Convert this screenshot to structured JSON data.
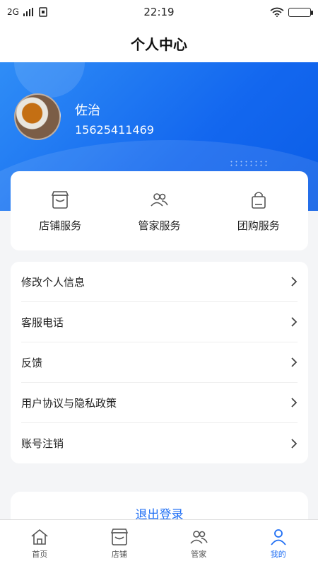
{
  "status_bar": {
    "network": "2G",
    "time": "22:19"
  },
  "header": {
    "title": "个人中心"
  },
  "user": {
    "name": "佐治",
    "phone": "15625411469"
  },
  "services": [
    {
      "label": "店铺服务",
      "icon": "store-icon"
    },
    {
      "label": "管家服务",
      "icon": "users-icon"
    },
    {
      "label": "团购服务",
      "icon": "shopping-bag-icon"
    }
  ],
  "menu": [
    {
      "label": "修改个人信息"
    },
    {
      "label": "客服电话"
    },
    {
      "label": "反馈"
    },
    {
      "label": "用户协议与隐私政策"
    },
    {
      "label": "账号注销"
    }
  ],
  "logout_label": "退出登录",
  "tabs": [
    {
      "label": "首页",
      "icon": "home-icon"
    },
    {
      "label": "店铺",
      "icon": "store-icon"
    },
    {
      "label": "管家",
      "icon": "users-icon"
    },
    {
      "label": "我的",
      "icon": "user-icon",
      "active": true
    }
  ],
  "colors": {
    "accent": "#1e6ef4",
    "hero_start": "#2f8df6",
    "hero_end": "#0b5de6"
  }
}
